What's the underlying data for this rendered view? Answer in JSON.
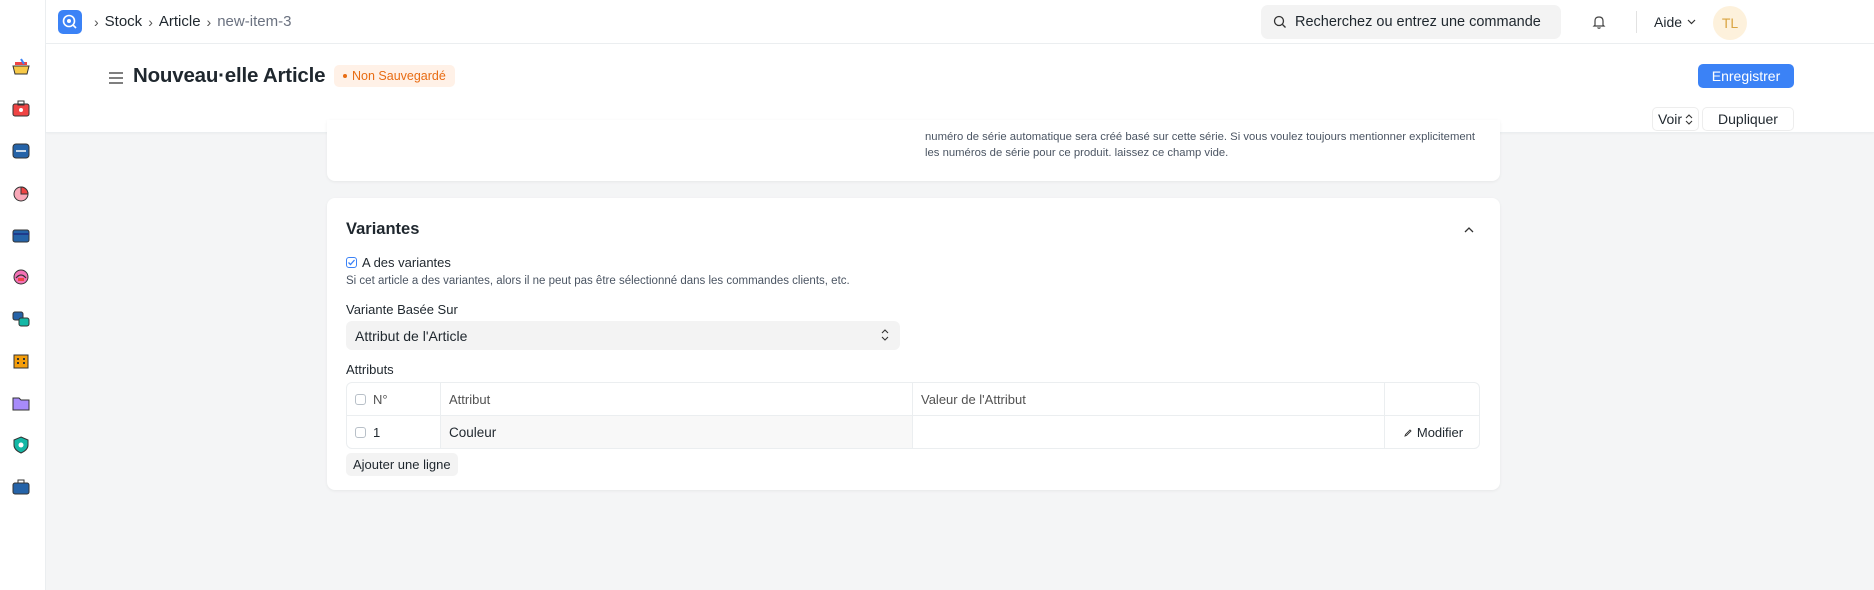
{
  "navbar": {
    "breadcrumbs": [
      "Stock",
      "Article",
      "new-item-3"
    ],
    "search_placeholder": "Recherchez ou entrez une commande",
    "help_label": "Aide",
    "avatar_initials": "TL"
  },
  "header": {
    "title": "Nouveau·elle Article",
    "status_badge": "Non Sauvegardé",
    "save_label": "Enregistrer",
    "view_label": "Voir",
    "duplicate_label": "Dupliquer"
  },
  "top_section": {
    "description": "numéro de série automatique sera créé basé sur cette série. Si vous voulez toujours mentionner explicitement les numéros de série pour ce produit. laissez ce champ vide."
  },
  "variants": {
    "title": "Variantes",
    "has_variants_label": "A des variantes",
    "has_variants_checked": true,
    "has_variants_help": "Si cet article a des variantes, alors il ne peut pas être sélectionné dans les commandes clients, etc.",
    "based_on_label": "Variante Basée Sur",
    "based_on_value": "Attribut de l'Article",
    "attributes_label": "Attributs",
    "table": {
      "columns": [
        "N°",
        "Attribut",
        "Valeur de l'Attribut",
        ""
      ],
      "rows": [
        {
          "no": "1",
          "attribute": "Couleur",
          "value": "",
          "action": "Modifier"
        }
      ]
    },
    "add_row_label": "Ajouter une ligne"
  },
  "sidebar_icons": [
    "shopping-basket-icon",
    "toolbox-icon",
    "inbox-icon",
    "pie-chart-icon",
    "wallet-icon",
    "headset-icon",
    "stack-icon",
    "building-icon",
    "folder-icon",
    "shield-icon",
    "briefcase-icon"
  ],
  "colors": {
    "primary": "#3b82f6",
    "warning": "#e86c13",
    "warning_bg": "#fff1e7"
  }
}
